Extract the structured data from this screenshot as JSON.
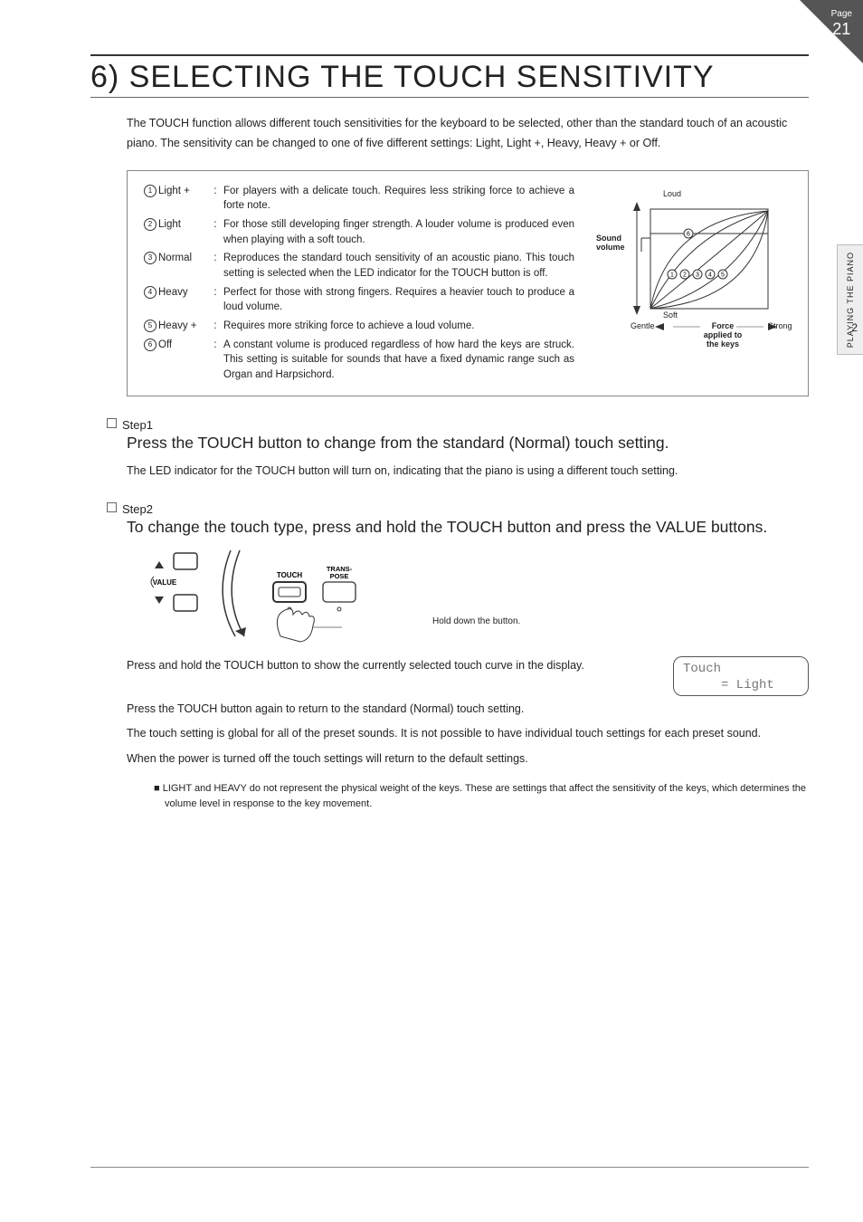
{
  "page": {
    "label": "Page",
    "number": "21"
  },
  "side_tab": {
    "text": "PLAYING THE PIANO",
    "chapter": "2"
  },
  "title": "6) SELECTING THE TOUCH SENSITIVITY",
  "intro": "The TOUCH function allows different touch sensitivities for the keyboard to be selected, other than the standard touch of an acoustic piano. The sensitivity can be changed to one of five different settings: Light, Light +, Heavy, Heavy + or Off.",
  "options": [
    {
      "num": "1",
      "name": "Light +",
      "desc": "For players with a delicate touch. Requires less striking force to achieve a forte note."
    },
    {
      "num": "2",
      "name": "Light",
      "desc": "For those still developing finger strength. A louder volume is produced even when playing with a soft touch."
    },
    {
      "num": "3",
      "name": "Normal",
      "desc": "Reproduces the standard touch sensitivity of an acoustic piano. This touch setting is selected when the LED indicator for the TOUCH button is off."
    },
    {
      "num": "4",
      "name": "Heavy",
      "desc": "Perfect for those with strong fingers. Requires a heavier touch to produce a loud volume."
    },
    {
      "num": "5",
      "name": "Heavy +",
      "desc": "Requires more striking force to achieve a loud volume."
    },
    {
      "num": "6",
      "name": "Off",
      "desc": "A constant volume is produced regardless of how hard the keys are struck. This setting is suitable for sounds that have a fixed dynamic range such as Organ and Harpsichord."
    }
  ],
  "graph": {
    "y_top": "Loud",
    "y_bottom": "Soft",
    "y_label1": "Sound",
    "y_label2": "volume",
    "x_left": "Gentle",
    "x_right": "Strong",
    "x_label1": "Force",
    "x_label2": "applied to",
    "x_label3": "the keys",
    "curve_labels": [
      "1",
      "2",
      "3",
      "4",
      "5"
    ],
    "flat_label": "6"
  },
  "steps": {
    "s1": {
      "head": "Step1",
      "main": "Press the TOUCH button to change from the standard (Normal) touch setting.",
      "body": "The LED indicator for the TOUCH button will turn on, indicating that the piano is using a different touch setting."
    },
    "s2": {
      "head": "Step2",
      "main": "To change the touch type, press and hold the TOUCH button and press the VALUE buttons.",
      "illus_caption": "Hold down the button.",
      "btn_value": "VALUE",
      "btn_touch": "TOUCH",
      "btn_trans": "TRANS-\nPOSE",
      "body1": "Press and hold the TOUCH button to show the currently selected touch curve in the display.",
      "lcd_line1": "Touch",
      "lcd_line2": "     = Light",
      "body2": "Press the TOUCH button again to return to the standard (Normal) touch setting.",
      "body3": "The touch setting is global for all of the preset sounds. It is not possible to have individual touch settings for each preset sound.",
      "body4": "When the power is turned off the touch settings will return to the default settings."
    }
  },
  "note": "LIGHT and HEAVY do not represent the physical weight of the keys. These are settings that affect the sensitivity of the keys, which determines the volume level in response to the key movement."
}
